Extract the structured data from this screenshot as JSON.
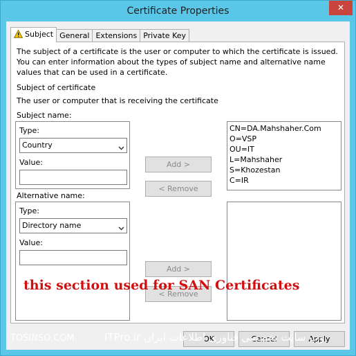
{
  "window": {
    "title": "Certificate Properties",
    "close_glyph": "✕"
  },
  "tabs": [
    {
      "label": "Subject",
      "icon": "warning-icon"
    },
    {
      "label": "General"
    },
    {
      "label": "Extensions"
    },
    {
      "label": "Private Key"
    }
  ],
  "subject_tab": {
    "description": "The subject of a certificate is the user or computer to which the certificate is issued. You can enter information about the types of subject name and alternative name values that can be used in a certificate.",
    "subject_heading": "Subject of certificate",
    "subject_subtext": "The user or computer that is receiving the certificate",
    "subject_name": {
      "group_label": "Subject name:",
      "type_label": "Type:",
      "type_value": "Country",
      "value_label": "Value:",
      "value": ""
    },
    "alternative_name": {
      "group_label": "Alternative name:",
      "type_label": "Type:",
      "type_value": "Directory name",
      "value_label": "Value:",
      "value": ""
    },
    "add_button": "Add >",
    "remove_button": "< Remove",
    "subject_values": [
      "CN=DA.Mahshaher.Com",
      "O=VSP",
      "OU=IT",
      "L=Mahshaher",
      "S=Khozestan",
      "C=IR"
    ],
    "alternative_values": []
  },
  "annotation": "this section used for SAN Certificates",
  "footer": {
    "ok_button": "OK",
    "cancel_button": "Cancel",
    "apply_button": "Apply"
  },
  "watermark": {
    "left": "TOSINSO.COM",
    "right": "وب سایت تخصصی فناوری اطلاعات ایران ITPro.ir"
  },
  "colors": {
    "frame": "#5bc7e8",
    "close": "#c7453d",
    "annotation": "#d01010"
  }
}
